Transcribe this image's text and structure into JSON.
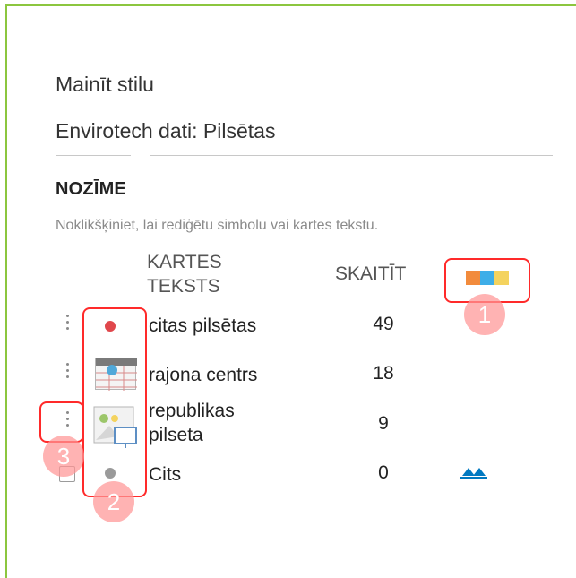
{
  "panel": {
    "title": "Mainīt stilu",
    "layer_name": "Envirotech dati: Pilsētas",
    "section_heading": "NOZĪME",
    "hint": "Noklikšķiniet, lai rediģētu simbolu vai kartes tekstu."
  },
  "columns": {
    "label_line1": "KARTES",
    "label_line2": "TEKSTS",
    "count": "SKAITĪT"
  },
  "palette_colors": [
    "#f28b3c",
    "#3eaee8",
    "#f4d35e"
  ],
  "rows": [
    {
      "label_line1": "citas pilsētas",
      "label_line2": "",
      "count": "49",
      "symbol": "red-dot-icon",
      "color": "#e0474c"
    },
    {
      "label_line1": "rajona centrs",
      "label_line2": "",
      "count": "18",
      "symbol": "table-icon",
      "color": "#4fa8d9"
    },
    {
      "label_line1": "republikas",
      "label_line2": "pilseta",
      "count": "9",
      "symbol": "image-picture-icon",
      "color": "#9cc66a"
    },
    {
      "label_line1": "Cits",
      "label_line2": "",
      "count": "0",
      "symbol": "gray-dot-icon",
      "color": "#9a9a9a"
    }
  ],
  "annotations": {
    "badge1": "1",
    "badge2": "2",
    "badge3": "3"
  },
  "accent_colors": {
    "panel_border": "#8cc63f",
    "annotation_red": "#ff2a2a",
    "sort_icon_blue": "#0079c1"
  }
}
